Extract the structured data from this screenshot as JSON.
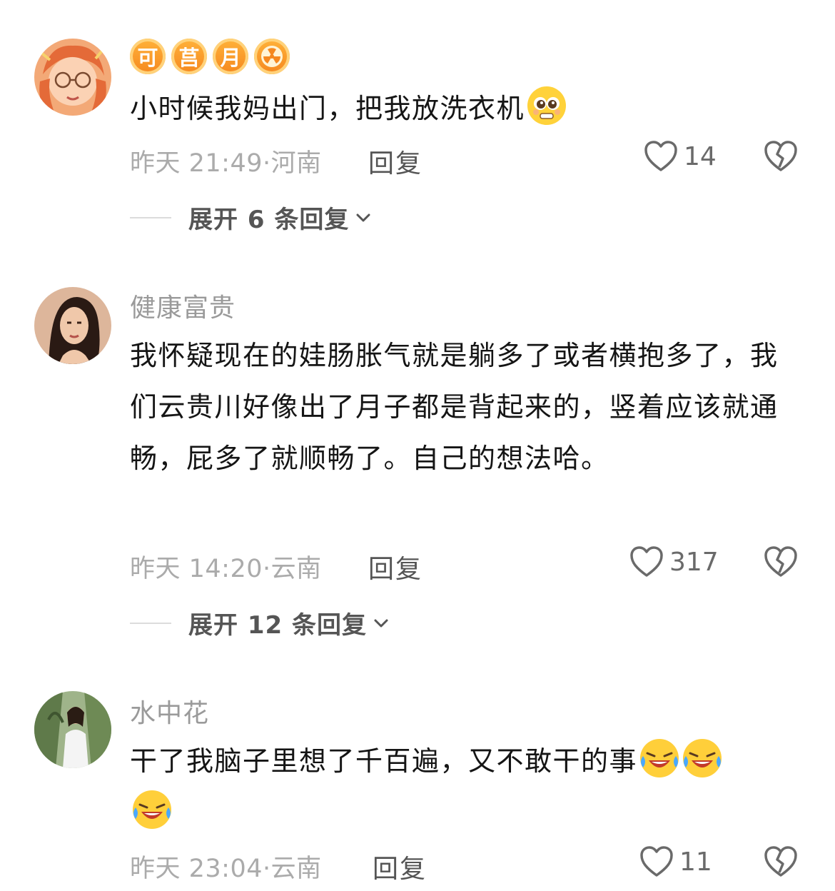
{
  "comments": [
    {
      "username": "",
      "badges": [
        "可",
        "莒",
        "月"
      ],
      "badge_icon": "radiation-icon",
      "text": "小时候我妈出门，把我放洗衣机",
      "emoji": "pleading-face-icon",
      "time": "昨天 21:49",
      "location": "河南",
      "reply_label": "回复",
      "likes": "14",
      "expand_label": "展开 6 条回复"
    },
    {
      "username": "健康富贵",
      "text": "我怀疑现在的娃肠胀气就是躺多了或者横抱多了，我们云贵川好像出了月子都是背起来的，竖着应该就通畅，屁多了就顺畅了。自己的想法哈。",
      "time": "昨天 14:20",
      "location": "云南",
      "reply_label": "回复",
      "likes": "317",
      "expand_label": "展开 12 条回复"
    },
    {
      "username": "水中花",
      "text": "干了我脑子里想了千百遍，又不敢干的事",
      "emoji": "laughing-crying-icon",
      "emoji_count": 3,
      "time": "昨天 23:04",
      "location": "云南",
      "reply_label": "回复",
      "likes": "11"
    }
  ],
  "colors": {
    "badge": "#f5881f",
    "meta_text": "#ababab",
    "username": "#9a9a9a"
  }
}
